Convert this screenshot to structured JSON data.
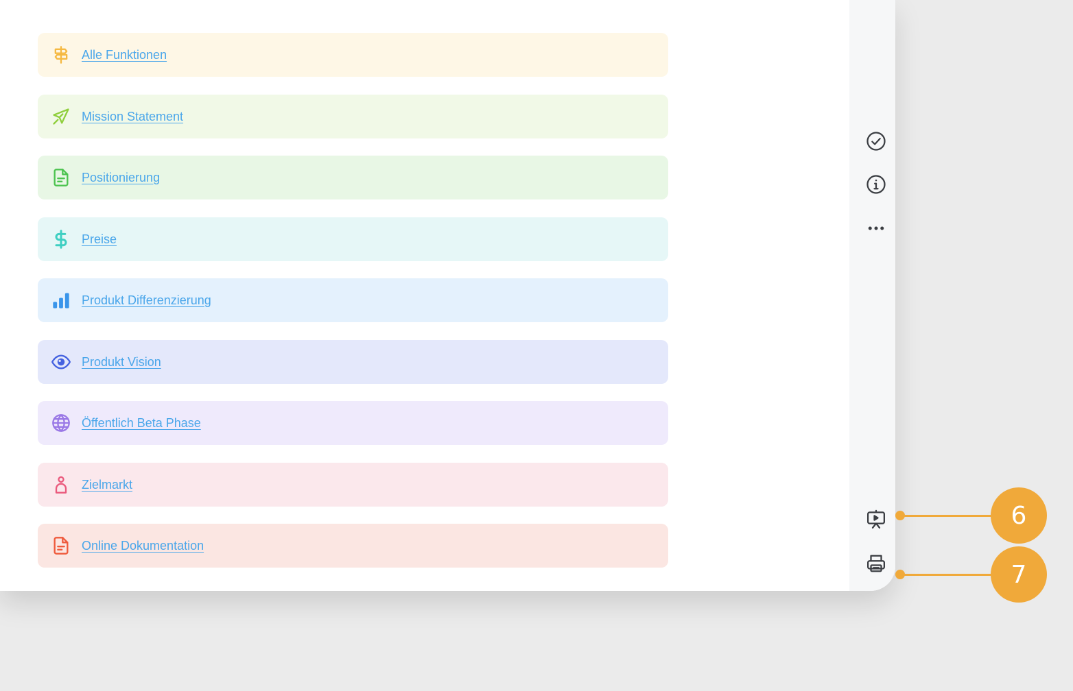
{
  "links": [
    {
      "label": "Alle Funktionen",
      "icon": "signpost-icon",
      "bg": "#fef7e6",
      "color": "#f5b942"
    },
    {
      "label": "Mission Statement",
      "icon": "airplane-icon",
      "bg": "#f1f9e7",
      "color": "#8fcf3c"
    },
    {
      "label": "Positionierung",
      "icon": "document-icon",
      "bg": "#e8f7e5",
      "color": "#4cc34f"
    },
    {
      "label": "Preise",
      "icon": "dollar-icon",
      "bg": "#e6f7f7",
      "color": "#3fcfc2"
    },
    {
      "label": "Produkt Differenzierung",
      "icon": "bar-chart-icon",
      "bg": "#e4f1fd",
      "color": "#3a95ea"
    },
    {
      "label": "Produkt Vision",
      "icon": "eye-icon",
      "bg": "#e4e8fb",
      "color": "#4562e0"
    },
    {
      "label": "Öffentlich Beta Phase",
      "icon": "globe-icon",
      "bg": "#efeafc",
      "color": "#9a78e6"
    },
    {
      "label": "Zielmarkt",
      "icon": "person-icon",
      "bg": "#fbe8ec",
      "color": "#ea5a7d"
    },
    {
      "label": "Online Dokumentation",
      "icon": "document-icon",
      "bg": "#fbe6e2",
      "color": "#ef5a3c"
    }
  ],
  "sidebar": {
    "buttons": [
      "check-circle-icon",
      "info-icon",
      "more-icon",
      "presentation-icon",
      "printer-icon"
    ]
  },
  "callouts": [
    {
      "number": "6",
      "target": "presentation-icon"
    },
    {
      "number": "7",
      "target": "printer-icon"
    }
  ],
  "colors": {
    "link": "#4aa6ea",
    "accent": "#f0a93a",
    "icon": "#3a3d42"
  }
}
